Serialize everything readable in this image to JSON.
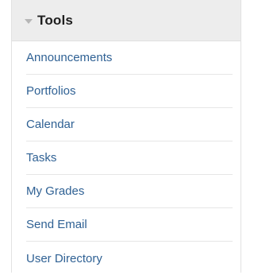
{
  "tools_panel": {
    "title": "Tools",
    "collapse_icon": "chevron-down-icon",
    "items": [
      {
        "label": "Announcements"
      },
      {
        "label": "Portfolios"
      },
      {
        "label": "Calendar"
      },
      {
        "label": "Tasks"
      },
      {
        "label": "My Grades"
      },
      {
        "label": "Send Email"
      },
      {
        "label": "User Directory"
      }
    ]
  },
  "colors": {
    "header_background": "#ededed",
    "link": "#2f6194",
    "title": "#1f1f1f",
    "divider": "#e6e6e6"
  }
}
